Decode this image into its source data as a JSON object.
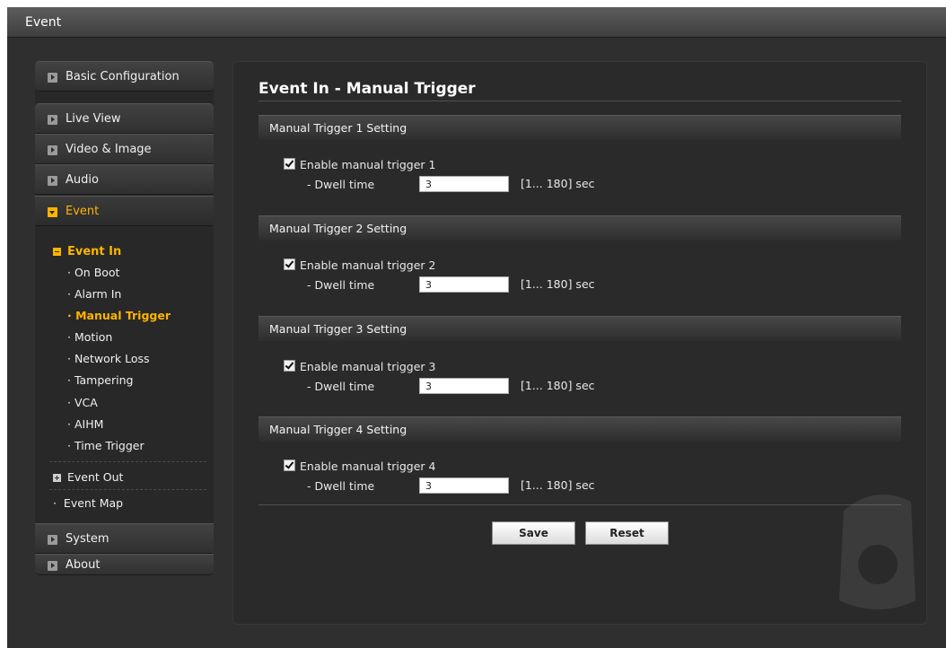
{
  "window": {
    "title": "Event"
  },
  "sidebar": {
    "top_items": [
      {
        "label": "Basic Configuration"
      },
      {
        "label": "Live View"
      },
      {
        "label": "Video & Image"
      },
      {
        "label": "Audio"
      },
      {
        "label": "Event"
      }
    ],
    "event_in": {
      "label": "Event In",
      "items": [
        "On Boot",
        "Alarm In",
        "Manual Trigger",
        "Motion",
        "Network Loss",
        "Tampering",
        "VCA",
        "AIHM",
        "Time Trigger"
      ],
      "current": "Manual Trigger"
    },
    "event_out": {
      "label": "Event Out"
    },
    "event_map": {
      "label": "Event Map"
    },
    "bottom_items": [
      {
        "label": "System"
      },
      {
        "label": "About"
      }
    ]
  },
  "main": {
    "title": "Event In - Manual Trigger",
    "sections": [
      {
        "header": "Manual Trigger 1 Setting",
        "checkbox_label": "Enable manual trigger 1",
        "checked": true,
        "dwell_label": "- Dwell time",
        "dwell_value": "3",
        "range": "[1... 180] sec"
      },
      {
        "header": "Manual Trigger 2 Setting",
        "checkbox_label": "Enable manual trigger 2",
        "checked": true,
        "dwell_label": "- Dwell time",
        "dwell_value": "3",
        "range": "[1... 180] sec"
      },
      {
        "header": "Manual Trigger 3 Setting",
        "checkbox_label": "Enable manual trigger 3",
        "checked": true,
        "dwell_label": "- Dwell time",
        "dwell_value": "3",
        "range": "[1... 180] sec"
      },
      {
        "header": "Manual Trigger 4 Setting",
        "checkbox_label": "Enable manual trigger 4",
        "checked": true,
        "dwell_label": "- Dwell time",
        "dwell_value": "3",
        "range": "[1... 180] sec"
      }
    ],
    "buttons": {
      "save": "Save",
      "reset": "Reset"
    }
  },
  "colors": {
    "accent": "#ffb400",
    "background": "#2f2f2f",
    "panel": "#2a2a2a"
  }
}
